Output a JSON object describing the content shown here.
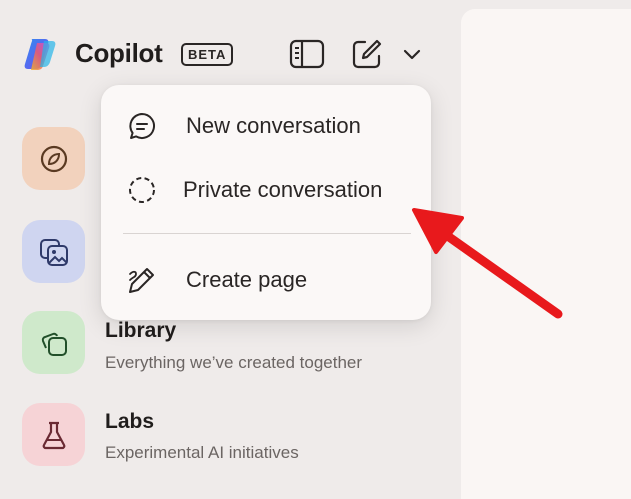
{
  "header": {
    "brand": "Copilot",
    "badge": "BETA"
  },
  "nav": [
    {
      "title": "",
      "subtitle": "",
      "tile_color": "#f2d2bd",
      "icon": "compass-icon"
    },
    {
      "title": "",
      "subtitle": "",
      "tile_color": "#cfd5f0",
      "icon": "image-gallery-icon"
    },
    {
      "title": "Library",
      "subtitle": "Everything we’ve created together",
      "tile_color": "#cfe9cb",
      "icon": "copy-squares-icon"
    },
    {
      "title": "Labs",
      "subtitle": "Experimental AI initiatives",
      "tile_color": "#f6d3d6",
      "icon": "flask-icon"
    }
  ],
  "menu": {
    "items": [
      {
        "label": "New conversation",
        "icon": "chat-bubble-icon"
      },
      {
        "label": "Private conversation",
        "icon": "dashed-circle-icon"
      },
      {
        "label": "Create page",
        "icon": "pen-icon"
      }
    ]
  },
  "colors": {
    "background": "#efebea",
    "panel": "#fbf8f7",
    "arrow": "#e8191c",
    "text": "#201d1c",
    "muted": "#6b6563"
  }
}
